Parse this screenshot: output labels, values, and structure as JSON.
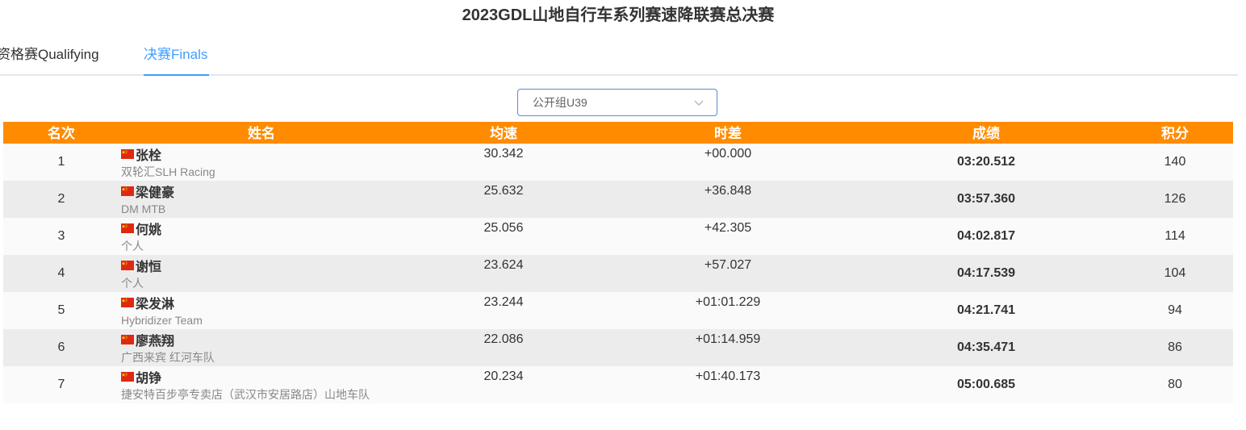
{
  "page": {
    "title": "2023GDL山地自行车系列赛速降联赛总决赛"
  },
  "tabs": [
    {
      "label": "资格赛Qualifying",
      "active": false
    },
    {
      "label": "决赛Finals",
      "active": true
    }
  ],
  "group_select": {
    "value": "公开组U39"
  },
  "table": {
    "headers": {
      "rank": "名次",
      "name": "姓名",
      "speed": "均速",
      "gap": "时差",
      "time": "成绩",
      "points": "积分"
    },
    "rows": [
      {
        "rank": "1",
        "flag": "china-flag-icon",
        "name": "张栓",
        "team": "双轮汇SLH Racing",
        "speed": "30.342",
        "gap": "+00.000",
        "time": "03:20.512",
        "points": "140"
      },
      {
        "rank": "2",
        "flag": "china-flag-icon",
        "name": "梁健豪",
        "team": "DM MTB",
        "speed": "25.632",
        "gap": "+36.848",
        "time": "03:57.360",
        "points": "126"
      },
      {
        "rank": "3",
        "flag": "china-flag-icon",
        "name": "何姚",
        "team": "个人",
        "speed": "25.056",
        "gap": "+42.305",
        "time": "04:02.817",
        "points": "114"
      },
      {
        "rank": "4",
        "flag": "china-flag-icon",
        "name": "谢恒",
        "team": "个人",
        "speed": "23.624",
        "gap": "+57.027",
        "time": "04:17.539",
        "points": "104"
      },
      {
        "rank": "5",
        "flag": "china-flag-icon",
        "name": "梁发淋",
        "team": "Hybridizer Team",
        "speed": "23.244",
        "gap": "+01:01.229",
        "time": "04:21.741",
        "points": "94"
      },
      {
        "rank": "6",
        "flag": "china-flag-icon",
        "name": "廖燕翔",
        "team": "广西来宾 红河车队",
        "speed": "22.086",
        "gap": "+01:14.959",
        "time": "04:35.471",
        "points": "86"
      },
      {
        "rank": "7",
        "flag": "china-flag-icon",
        "name": "胡铮",
        "team": "捷安特百步亭专卖店（武汉市安居路店）山地车队",
        "speed": "20.234",
        "gap": "+01:40.173",
        "time": "05:00.685",
        "points": "80"
      }
    ]
  },
  "colors": {
    "header_bg": "#ff8c00",
    "accent": "#409eff",
    "flag_red": "#de2910",
    "flag_yellow": "#ffde00"
  }
}
